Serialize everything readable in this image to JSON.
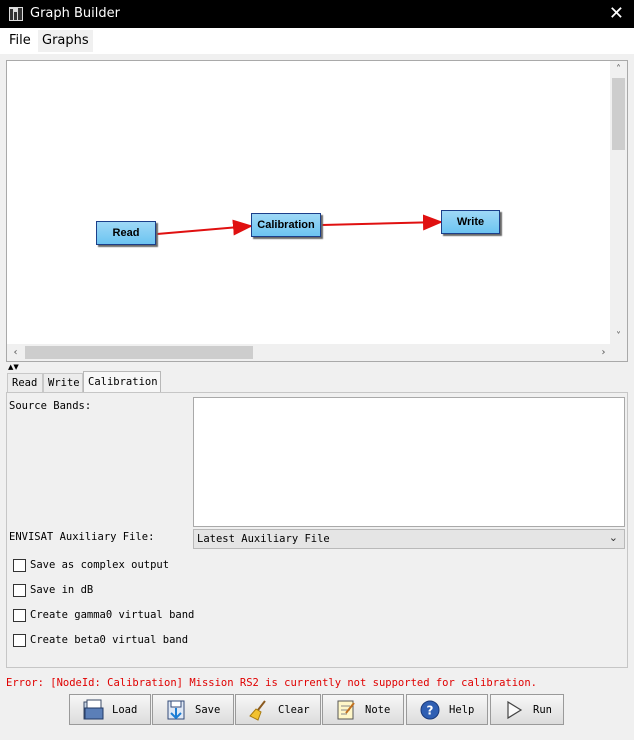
{
  "window": {
    "title": "Graph Builder",
    "app_icon": "graph-builder-icon",
    "close_icon": "close-icon"
  },
  "menu": {
    "items": [
      "File",
      "Graphs"
    ]
  },
  "graph": {
    "nodes": [
      {
        "id": "read",
        "label": "Read"
      },
      {
        "id": "calibration",
        "label": "Calibration"
      },
      {
        "id": "write",
        "label": "Write"
      }
    ],
    "edges": [
      {
        "from": "Read",
        "to": "Calibration"
      },
      {
        "from": "Calibration",
        "to": "Write"
      }
    ],
    "node_color": "#7ccbf3",
    "edge_color": "#e01010"
  },
  "tabs": [
    "Read",
    "Write",
    "Calibration"
  ],
  "active_tab": "Calibration",
  "calibration": {
    "source_bands_label": "Source Bands:",
    "aux_file_label": "ENVISAT Auxiliary File:",
    "aux_file_value": "Latest Auxiliary File",
    "checkboxes": [
      {
        "label": "Save as complex output",
        "checked": false
      },
      {
        "label": "Save in dB",
        "checked": false
      },
      {
        "label": "Create gamma0 virtual band",
        "checked": false
      },
      {
        "label": "Create beta0 virtual band",
        "checked": false
      }
    ]
  },
  "status": {
    "error": "Error: [NodeId: Calibration] Mission RS2 is currently not supported for calibration.",
    "error_color": "#e00000"
  },
  "buttons": [
    {
      "label": "Load",
      "icon": "folder-icon"
    },
    {
      "label": "Save",
      "icon": "save-icon"
    },
    {
      "label": "Clear",
      "icon": "broom-icon"
    },
    {
      "label": "Note",
      "icon": "note-icon"
    },
    {
      "label": "Help",
      "icon": "help-icon"
    },
    {
      "label": "Run",
      "icon": "play-icon"
    }
  ]
}
